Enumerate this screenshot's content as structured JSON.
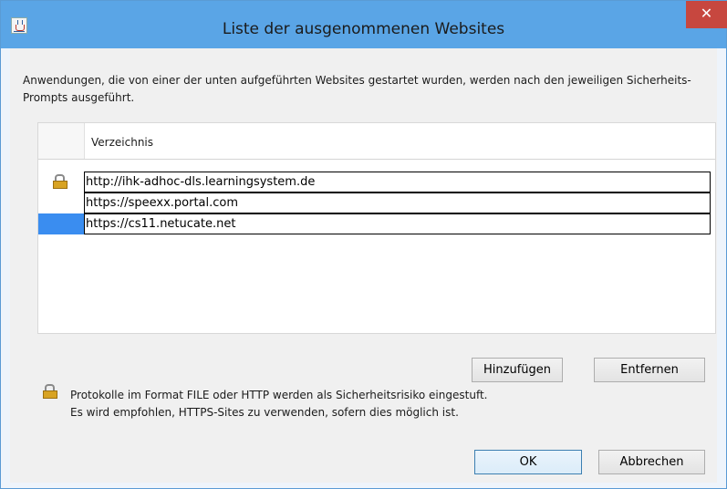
{
  "window": {
    "title": "Liste der ausgenommenen Websites",
    "close_symbol": "✕"
  },
  "description": "Anwendungen, die von einer der unten aufgeführten Websites gestartet wurden, werden nach den jeweiligen Sicherheits-Prompts ausgeführt.",
  "table": {
    "column_header": "Verzeichnis",
    "rows": [
      {
        "url": "http://ihk-adhoc-dls.learningsystem.de",
        "icon": "lock-icon",
        "selected": false
      },
      {
        "url": "https://speexx.portal.com",
        "icon": "",
        "selected": false
      },
      {
        "url": "https://cs11.netucate.net",
        "icon": "",
        "selected": true
      }
    ]
  },
  "buttons": {
    "add": "Hinzufügen",
    "remove": "Entfernen",
    "ok": "OK",
    "cancel": "Abbrechen"
  },
  "info": {
    "line1": "Protokolle im Format FILE oder HTTP werden als Sicherheitsrisiko eingestuft.",
    "line2": "Es wird empfohlen, HTTPS-Sites zu verwenden, sofern dies möglich ist.",
    "icon": "lock-icon"
  },
  "colors": {
    "titlebar": "#5aa5e6",
    "close": "#c7473f",
    "selection": "#3a8df0"
  }
}
